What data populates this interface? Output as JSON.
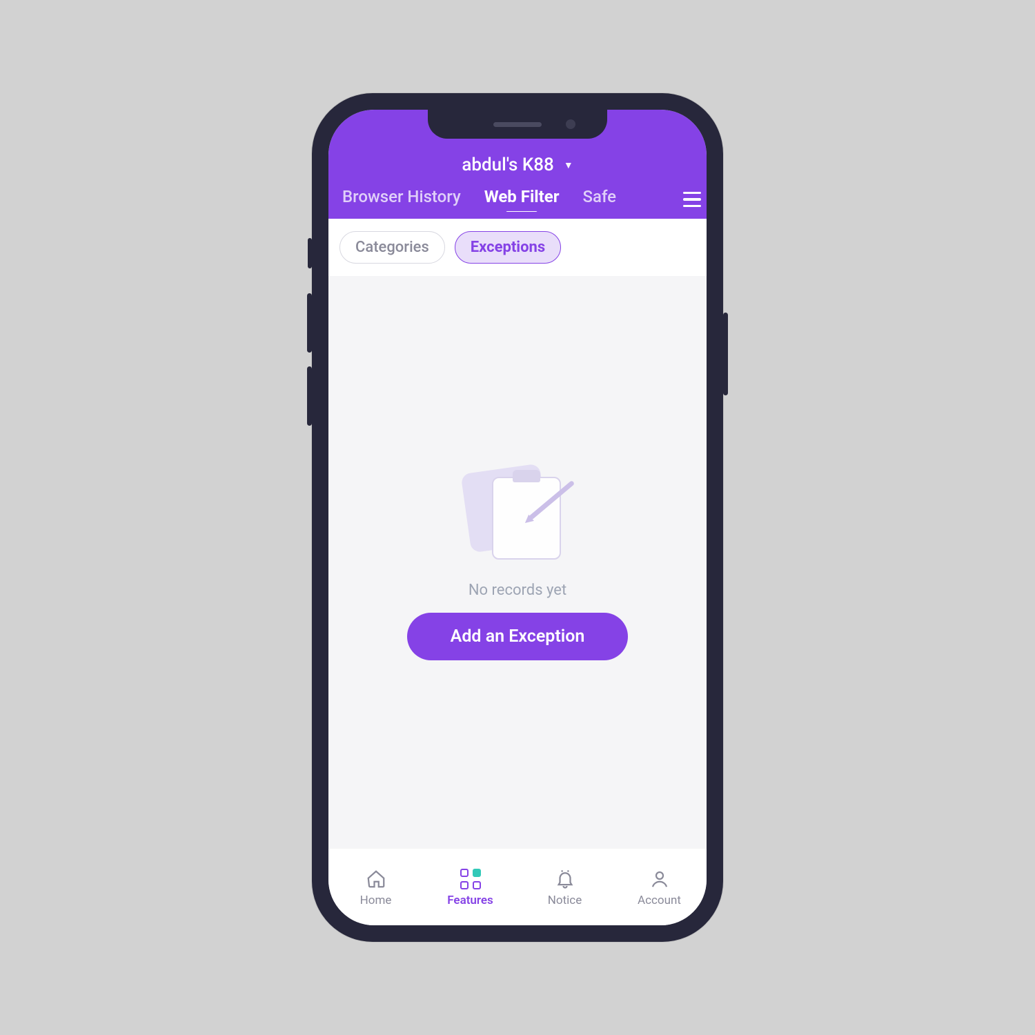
{
  "header": {
    "device_name": "abdul's K88",
    "tabs": [
      "Browser History",
      "Web Filter",
      "Safe"
    ],
    "active_tab_index": 1
  },
  "pills": {
    "items": [
      "Categories",
      "Exceptions"
    ],
    "active_index": 1
  },
  "empty_state": {
    "message": "No records yet",
    "cta_label": "Add an Exception"
  },
  "bottom_nav": {
    "items": [
      {
        "label": "Home"
      },
      {
        "label": "Features"
      },
      {
        "label": "Notice"
      },
      {
        "label": "Account"
      }
    ],
    "active_index": 1
  }
}
